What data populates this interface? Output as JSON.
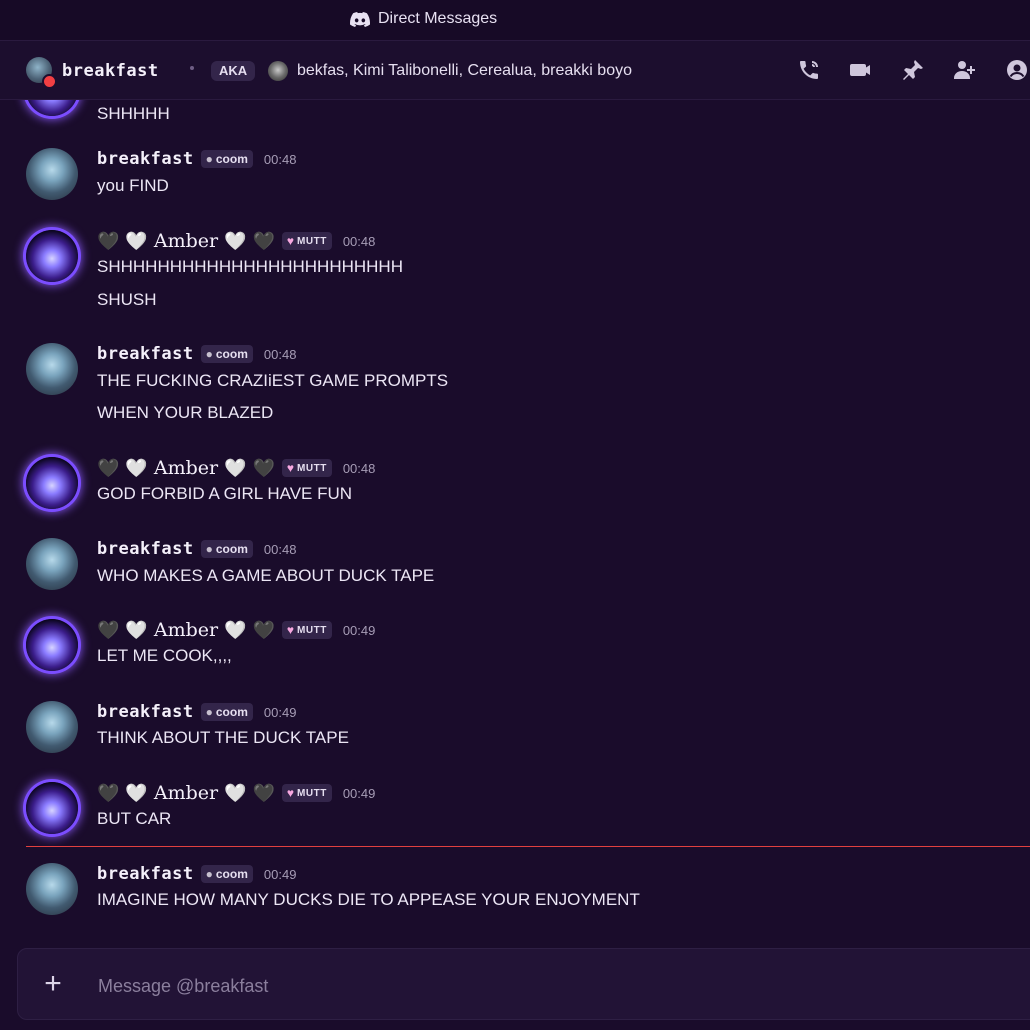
{
  "window": {
    "title": "Direct Messages"
  },
  "header": {
    "name": "breakfast",
    "aka_label": "AKA",
    "aka_names": "bekfas, Kimi Talibonelli, Cerealua, breakki boyo",
    "icons": [
      "voice-call-icon",
      "video-call-icon",
      "pin-icon",
      "add-friends-icon",
      "profile-icon"
    ]
  },
  "users": {
    "breakfast": {
      "name": "breakfast",
      "tag": "coom",
      "tag_icon": "cookie-icon"
    },
    "amber": {
      "name": "Amber",
      "tag": "MUTT",
      "tag_icon": "pink-heart-icon",
      "deco_left": "🖤",
      "deco_right": "🤍"
    }
  },
  "messages": [
    {
      "user": "amber",
      "time": "",
      "lines": [
        "SHHHHH"
      ]
    },
    {
      "user": "breakfast",
      "time": "00:48",
      "lines": [
        "you FIND"
      ]
    },
    {
      "user": "amber",
      "time": "00:48",
      "lines": [
        "SHHHHHHHHHHHHHHHHHHHHHHHH",
        "SHUSH"
      ]
    },
    {
      "user": "breakfast",
      "time": "00:48",
      "lines": [
        "THE FUCKING CRAZIiEST GAME PROMPTS",
        "WHEN YOUR BLAZED"
      ]
    },
    {
      "user": "amber",
      "time": "00:48",
      "lines": [
        "GOD FORBID A GIRL HAVE FUN"
      ]
    },
    {
      "user": "breakfast",
      "time": "00:48",
      "lines": [
        "WHO MAKES A GAME ABOUT DUCK TAPE"
      ]
    },
    {
      "user": "amber",
      "time": "00:49",
      "lines": [
        "LET ME COOK,,,,"
      ]
    },
    {
      "user": "breakfast",
      "time": "00:49",
      "lines": [
        "THINK ABOUT THE DUCK TAPE"
      ]
    },
    {
      "user": "amber",
      "time": "00:49",
      "lines": [
        "BUT CAR"
      ]
    },
    {
      "user": "breakfast",
      "time": "00:49",
      "lines": [
        "IMAGINE HOW MANY DUCKS DIE TO APPEASE YOUR ENJOYMENT"
      ]
    }
  ],
  "composer": {
    "placeholder": "Message @breakfast",
    "value": ""
  },
  "colors": {
    "background": "#1a0c2b",
    "new_message_divider": "#e1403f",
    "dnd_status": "#f23f43"
  }
}
